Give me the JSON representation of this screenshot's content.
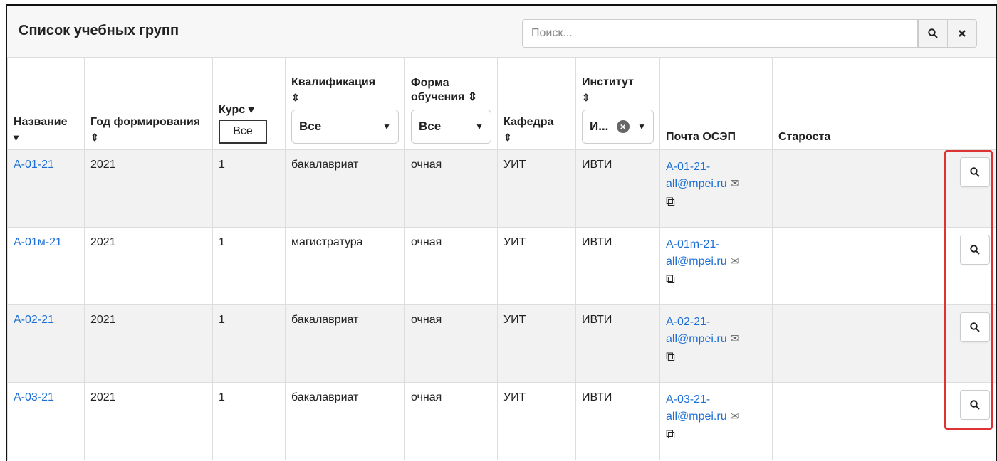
{
  "header": {
    "title": "Список учебных групп",
    "search_placeholder": "Поиск...",
    "search_icon": "search-icon",
    "clear_icon": "close-icon"
  },
  "columns": {
    "name": "Название",
    "year": "Год формирования",
    "course": "Курс",
    "course_filter": "Все",
    "qualification": "Квалификация",
    "qualification_filter": "Все",
    "study_form": "Форма обучения",
    "study_form_filter": "Все",
    "department": "Кафедра",
    "institute": "Институт",
    "institute_filter": "И...",
    "email": "Почта ОСЭП",
    "head": "Староста"
  },
  "rows": [
    {
      "name": "А-01-21",
      "year": "2021",
      "course": "1",
      "qualification": "бакалавриат",
      "study_form": "очная",
      "department": "УИТ",
      "institute": "ИВТИ",
      "email_part1": "А-01-21-",
      "email_part2": "all@mpei.ru",
      "head": ""
    },
    {
      "name": "А-01м-21",
      "year": "2021",
      "course": "1",
      "qualification": "магистратура",
      "study_form": "очная",
      "department": "УИТ",
      "institute": "ИВТИ",
      "email_part1": "А-01m-21-",
      "email_part2": "all@mpei.ru",
      "head": ""
    },
    {
      "name": "А-02-21",
      "year": "2021",
      "course": "1",
      "qualification": "бакалавриат",
      "study_form": "очная",
      "department": "УИТ",
      "institute": "ИВТИ",
      "email_part1": "А-02-21-",
      "email_part2": "all@mpei.ru",
      "head": ""
    },
    {
      "name": "А-03-21",
      "year": "2021",
      "course": "1",
      "qualification": "бакалавриат",
      "study_form": "очная",
      "department": "УИТ",
      "institute": "ИВТИ",
      "email_part1": "А-03-21-",
      "email_part2": "all@mpei.ru",
      "head": ""
    }
  ],
  "colors": {
    "accent": "#1d6fd6",
    "highlight": "#d33"
  }
}
